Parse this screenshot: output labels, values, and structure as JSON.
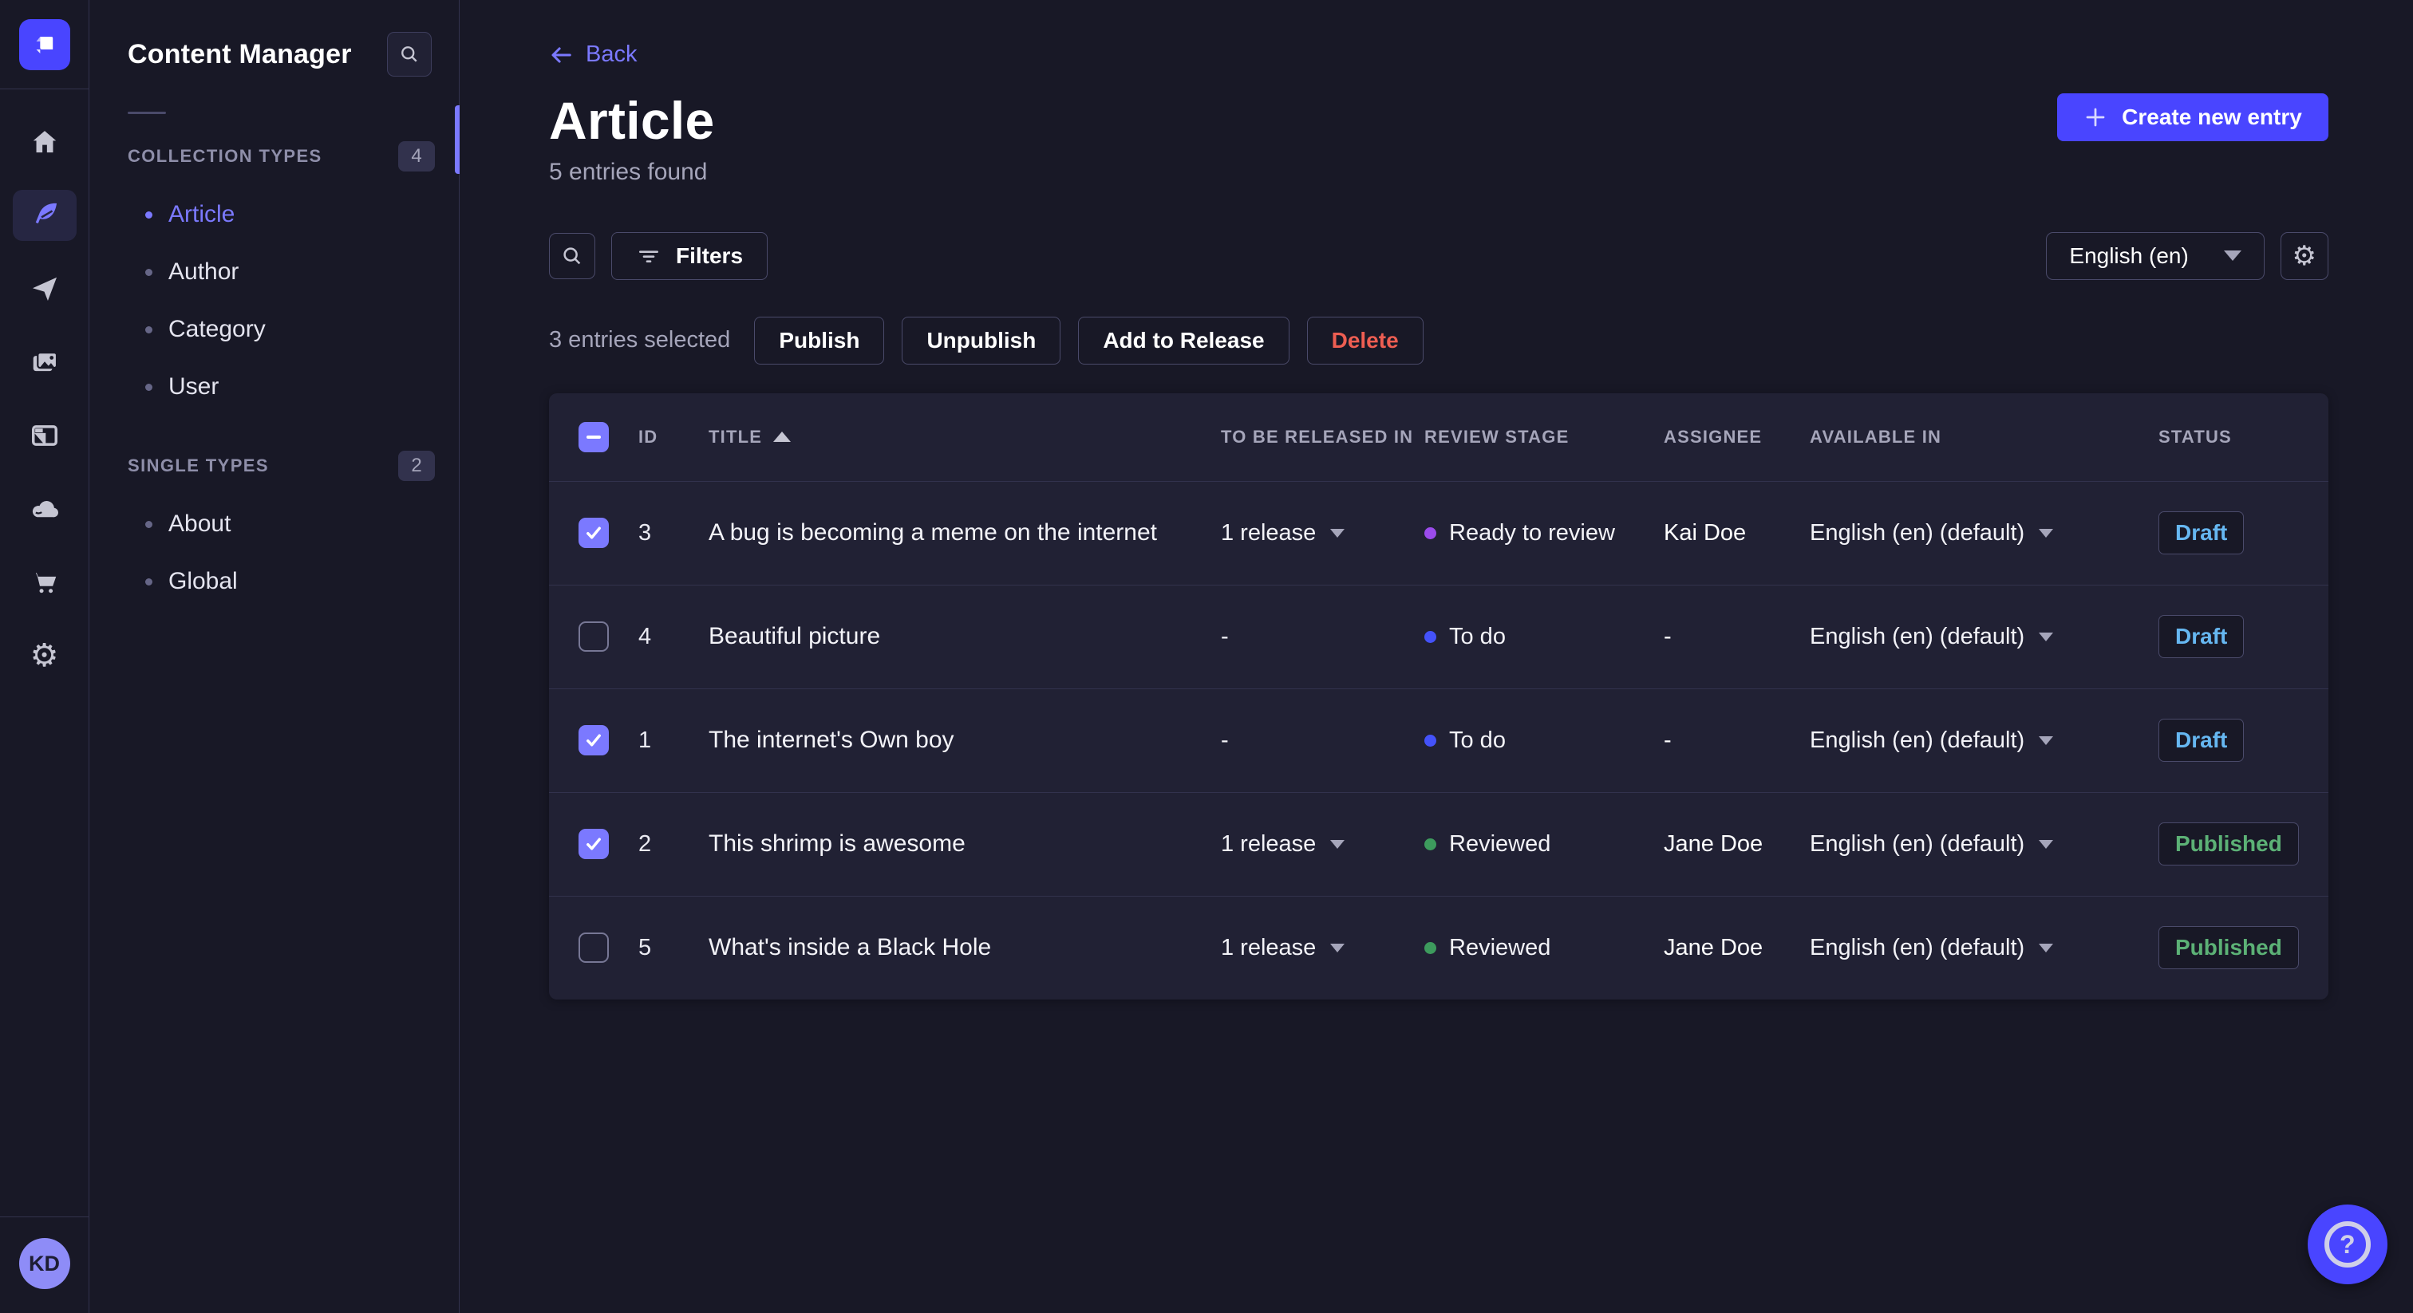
{
  "colors": {
    "accent": "#4945ff",
    "accent_light": "#7b79ff",
    "page_bg": "#181826",
    "panel_bg": "#212134",
    "border_subtle": "#32324d",
    "border_input": "#4a4a6a",
    "text_secondary": "#a5a5ba",
    "draft": "#66b7f1",
    "published": "#5cb176",
    "danger": "#ee5e52"
  },
  "nav_rail": {
    "items": [
      {
        "name": "home"
      },
      {
        "name": "content-manager",
        "active": true
      },
      {
        "name": "releases"
      },
      {
        "name": "media-library"
      },
      {
        "name": "content-type-builder"
      },
      {
        "name": "deploy"
      },
      {
        "name": "marketplace"
      },
      {
        "name": "settings"
      }
    ],
    "settings_glyph": "⚙"
  },
  "user": {
    "initials": "KD",
    "avatar_color": "#8e8cf7"
  },
  "subnav": {
    "title": "Content Manager",
    "sections": [
      {
        "label": "COLLECTION TYPES",
        "count": "4",
        "items": [
          {
            "label": "Article",
            "active": true
          },
          {
            "label": "Author"
          },
          {
            "label": "Category"
          },
          {
            "label": "User"
          }
        ]
      },
      {
        "label": "SINGLE TYPES",
        "count": "2",
        "items": [
          {
            "label": "About"
          },
          {
            "label": "Global"
          }
        ]
      }
    ]
  },
  "header": {
    "back_label": "Back",
    "title": "Article",
    "subtitle": "5 entries found",
    "create_button": "Create new entry"
  },
  "toolbar": {
    "filters_label": "Filters",
    "locale": "English (en)",
    "settings_glyph": "⚙"
  },
  "selection": {
    "text": "3 entries selected",
    "publish": "Publish",
    "unpublish": "Unpublish",
    "add_to_release": "Add to Release",
    "delete": "Delete"
  },
  "table": {
    "columns": [
      "ID",
      "TITLE",
      "TO BE RELEASED IN",
      "REVIEW STAGE",
      "ASSIGNEE",
      "AVAILABLE IN",
      "STATUS"
    ],
    "rows": [
      {
        "checked": true,
        "id": 3,
        "title": "A bug is becoming a meme on the internet",
        "release": "1 release",
        "stage": "Ready to review",
        "stage_color": "#9b4bec",
        "assignee": "Kai Doe",
        "available": "English (en) (default)",
        "status": "Draft",
        "status_color": "#66b7f1"
      },
      {
        "checked": false,
        "id": 4,
        "title": "Beautiful picture",
        "release": "-",
        "stage": "To do",
        "stage_color": "#4452fa",
        "assignee": "-",
        "available": "English (en) (default)",
        "status": "Draft",
        "status_color": "#66b7f1"
      },
      {
        "checked": true,
        "id": 1,
        "title": "The internet's Own boy",
        "release": "-",
        "stage": "To do",
        "stage_color": "#4452fa",
        "assignee": "-",
        "available": "English (en) (default)",
        "status": "Draft",
        "status_color": "#66b7f1"
      },
      {
        "checked": true,
        "id": 2,
        "title": "This shrimp is awesome",
        "release": "1 release",
        "stage": "Reviewed",
        "stage_color": "#3d9b5d",
        "assignee": "Jane Doe",
        "available": "English (en) (default)",
        "status": "Published",
        "status_color": "#5cb176"
      },
      {
        "checked": false,
        "id": 5,
        "title": "What's inside a Black Hole",
        "release": "1 release",
        "stage": "Reviewed",
        "stage_color": "#3d9b5d",
        "assignee": "Jane Doe",
        "available": "English (en) (default)",
        "status": "Published",
        "status_color": "#5cb176"
      }
    ]
  },
  "help": {
    "glyph": "?"
  }
}
